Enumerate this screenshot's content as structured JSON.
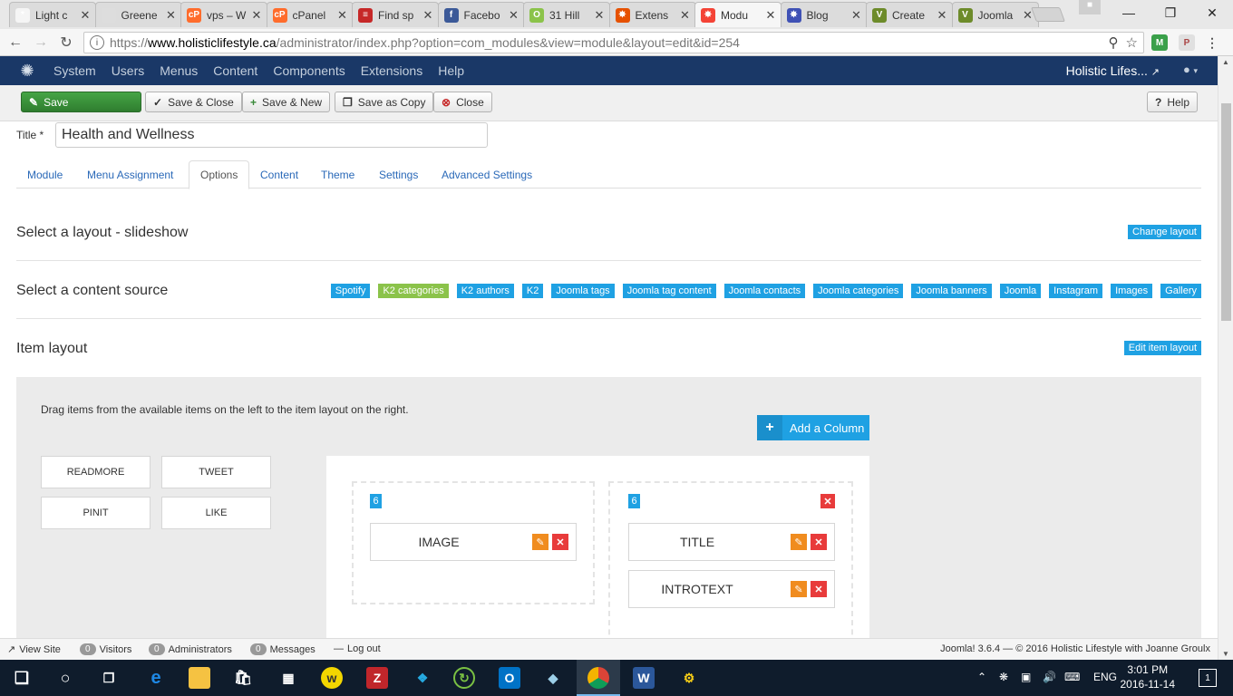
{
  "browser": {
    "tabs": [
      {
        "label": "Light c",
        "favicon_color": "#f5f5f5",
        "favicon_text": "*"
      },
      {
        "label": "Greene",
        "favicon_color": "#dddddd",
        "favicon_text": ""
      },
      {
        "label": "vps – W",
        "favicon_color": "#ff6c2c",
        "favicon_text": "cP"
      },
      {
        "label": "cPanel",
        "favicon_color": "#ff6c2c",
        "favicon_text": "cP"
      },
      {
        "label": "Find sp",
        "favicon_color": "#c62828",
        "favicon_text": "≡"
      },
      {
        "label": "Facebo",
        "favicon_color": "#3b5998",
        "favicon_text": "f"
      },
      {
        "label": "31 Hill",
        "favicon_color": "#8bc34a",
        "favicon_text": "O"
      },
      {
        "label": "Extens",
        "favicon_color": "#e65100",
        "favicon_text": "✸"
      },
      {
        "label": "Modu",
        "favicon_color": "#f44336",
        "favicon_text": "✸"
      },
      {
        "label": "Blog",
        "favicon_color": "#3f51b5",
        "favicon_text": "✸"
      },
      {
        "label": "Create",
        "favicon_color": "#6d8b2a",
        "favicon_text": "V"
      },
      {
        "label": "Joomla",
        "favicon_color": "#6d8b2a",
        "favicon_text": "V"
      }
    ],
    "active_tab_index": 8,
    "tab_close": "✕",
    "url_scheme": "https://",
    "url_host": "www.holisticlifestyle.ca",
    "url_rest": "/administrator/index.php?option=com_modules&view=module&layout=edit&id=254"
  },
  "adminbar": {
    "menu": [
      "System",
      "Users",
      "Menus",
      "Content",
      "Components",
      "Extensions",
      "Help"
    ],
    "site_name": "Holistic Lifes...",
    "site_link_icon": "↗",
    "user_icon": "▴"
  },
  "toolbar": {
    "save": "Save",
    "save_close": "Save & Close",
    "save_new": "Save & New",
    "save_copy": "Save as Copy",
    "close": "Close",
    "help": "Help"
  },
  "form": {
    "title_label": "Title *",
    "title_value": "Health and Wellness"
  },
  "tabs": [
    "Module",
    "Menu Assignment",
    "Options",
    "Content",
    "Theme",
    "Settings",
    "Advanced Settings"
  ],
  "active_tab": "Options",
  "sections": {
    "layout": {
      "title": "Select a layout - slideshow",
      "button": "Change layout"
    },
    "source": {
      "title": "Select a content source",
      "options": [
        "Spotify",
        "K2 categories",
        "K2 authors",
        "K2",
        "Joomla tags",
        "Joomla tag content",
        "Joomla contacts",
        "Joomla categories",
        "Joomla banners",
        "Joomla",
        "Instagram",
        "Images",
        "Gallery"
      ],
      "selected": "K2 categories"
    },
    "item_layout": {
      "title": "Item layout",
      "button": "Edit item layout"
    }
  },
  "builder": {
    "hint": "Drag items from the available items on the left to the item layout on the right.",
    "add_column": "Add a Column",
    "available": [
      "READMORE",
      "TWEET",
      "PINIT",
      "LIKE"
    ],
    "columns": [
      {
        "width": "6",
        "items": [
          "IMAGE"
        ]
      },
      {
        "width": "6",
        "items": [
          "TITLE",
          "INTROTEXT"
        ]
      }
    ]
  },
  "statusbar": {
    "view_site": "View Site",
    "visitors_count": "0",
    "visitors": "Visitors",
    "admins_count": "0",
    "admins": "Administrators",
    "messages_count": "0",
    "messages": "Messages",
    "logout": "Log out",
    "footer": "Joomla! 3.6.4  —  © 2016 Holistic Lifestyle with Joanne Groulx"
  },
  "taskbar": {
    "lang": "ENG",
    "time": "3:01 PM",
    "date": "2016-11-14",
    "notifications": "1"
  },
  "colors": {
    "admin_nav": "#1a3867",
    "accent_blue": "#1fa1e3",
    "save_green": "#46a546",
    "selected_green": "#8bc34a",
    "edit_orange": "#f08c1f",
    "delete_red": "#e83b3b"
  }
}
